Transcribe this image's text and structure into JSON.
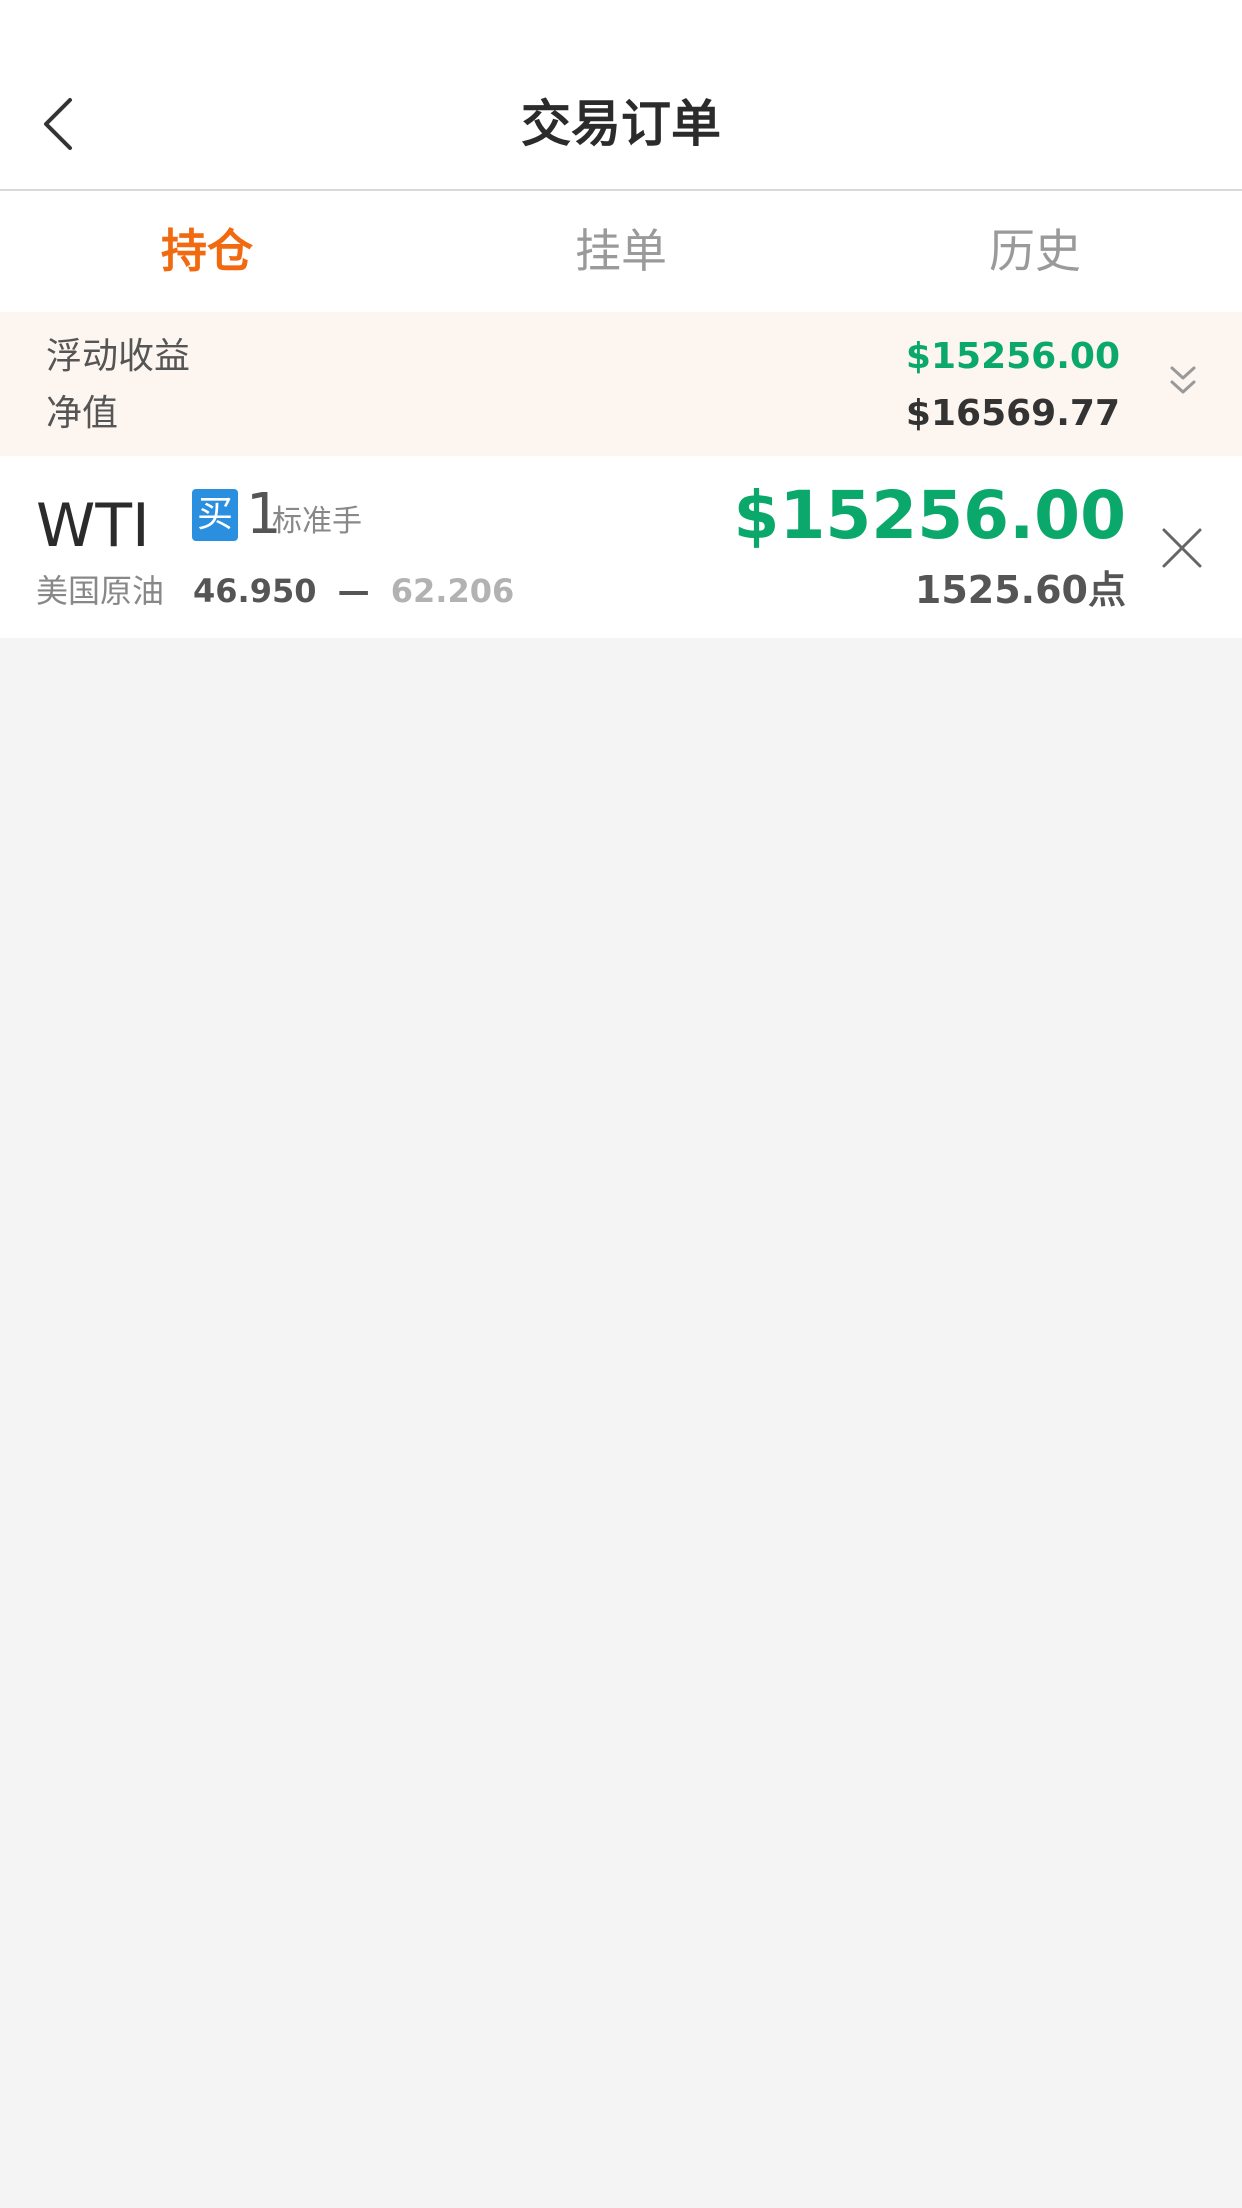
{
  "header": {
    "title": "交易订单",
    "back_icon": "chevron-left-icon"
  },
  "tabs": [
    {
      "label": "持仓",
      "active": true
    },
    {
      "label": "挂单",
      "active": false
    },
    {
      "label": "历史",
      "active": false
    }
  ],
  "summary": {
    "floating_label": "浮动收益",
    "floating_value": "$15256.00",
    "equity_label": "净值",
    "equity_value": "$16569.77",
    "expand_icon": "double-chevron-down-icon"
  },
  "position": {
    "symbol": "WTI",
    "side_badge": "买",
    "lots": "1",
    "lots_unit": "标准手",
    "product_name": "美国原油",
    "open_price": "46.950",
    "separator": "—",
    "current_price": "62.206",
    "profit": "$15256.00",
    "points": "1525.60点",
    "close_icon": "close-icon"
  },
  "colors": {
    "accent": "#f26a10",
    "profit_green": "#0aa86a",
    "buy_blue": "#2b8fe0",
    "summary_bg": "#fdf5ef"
  }
}
